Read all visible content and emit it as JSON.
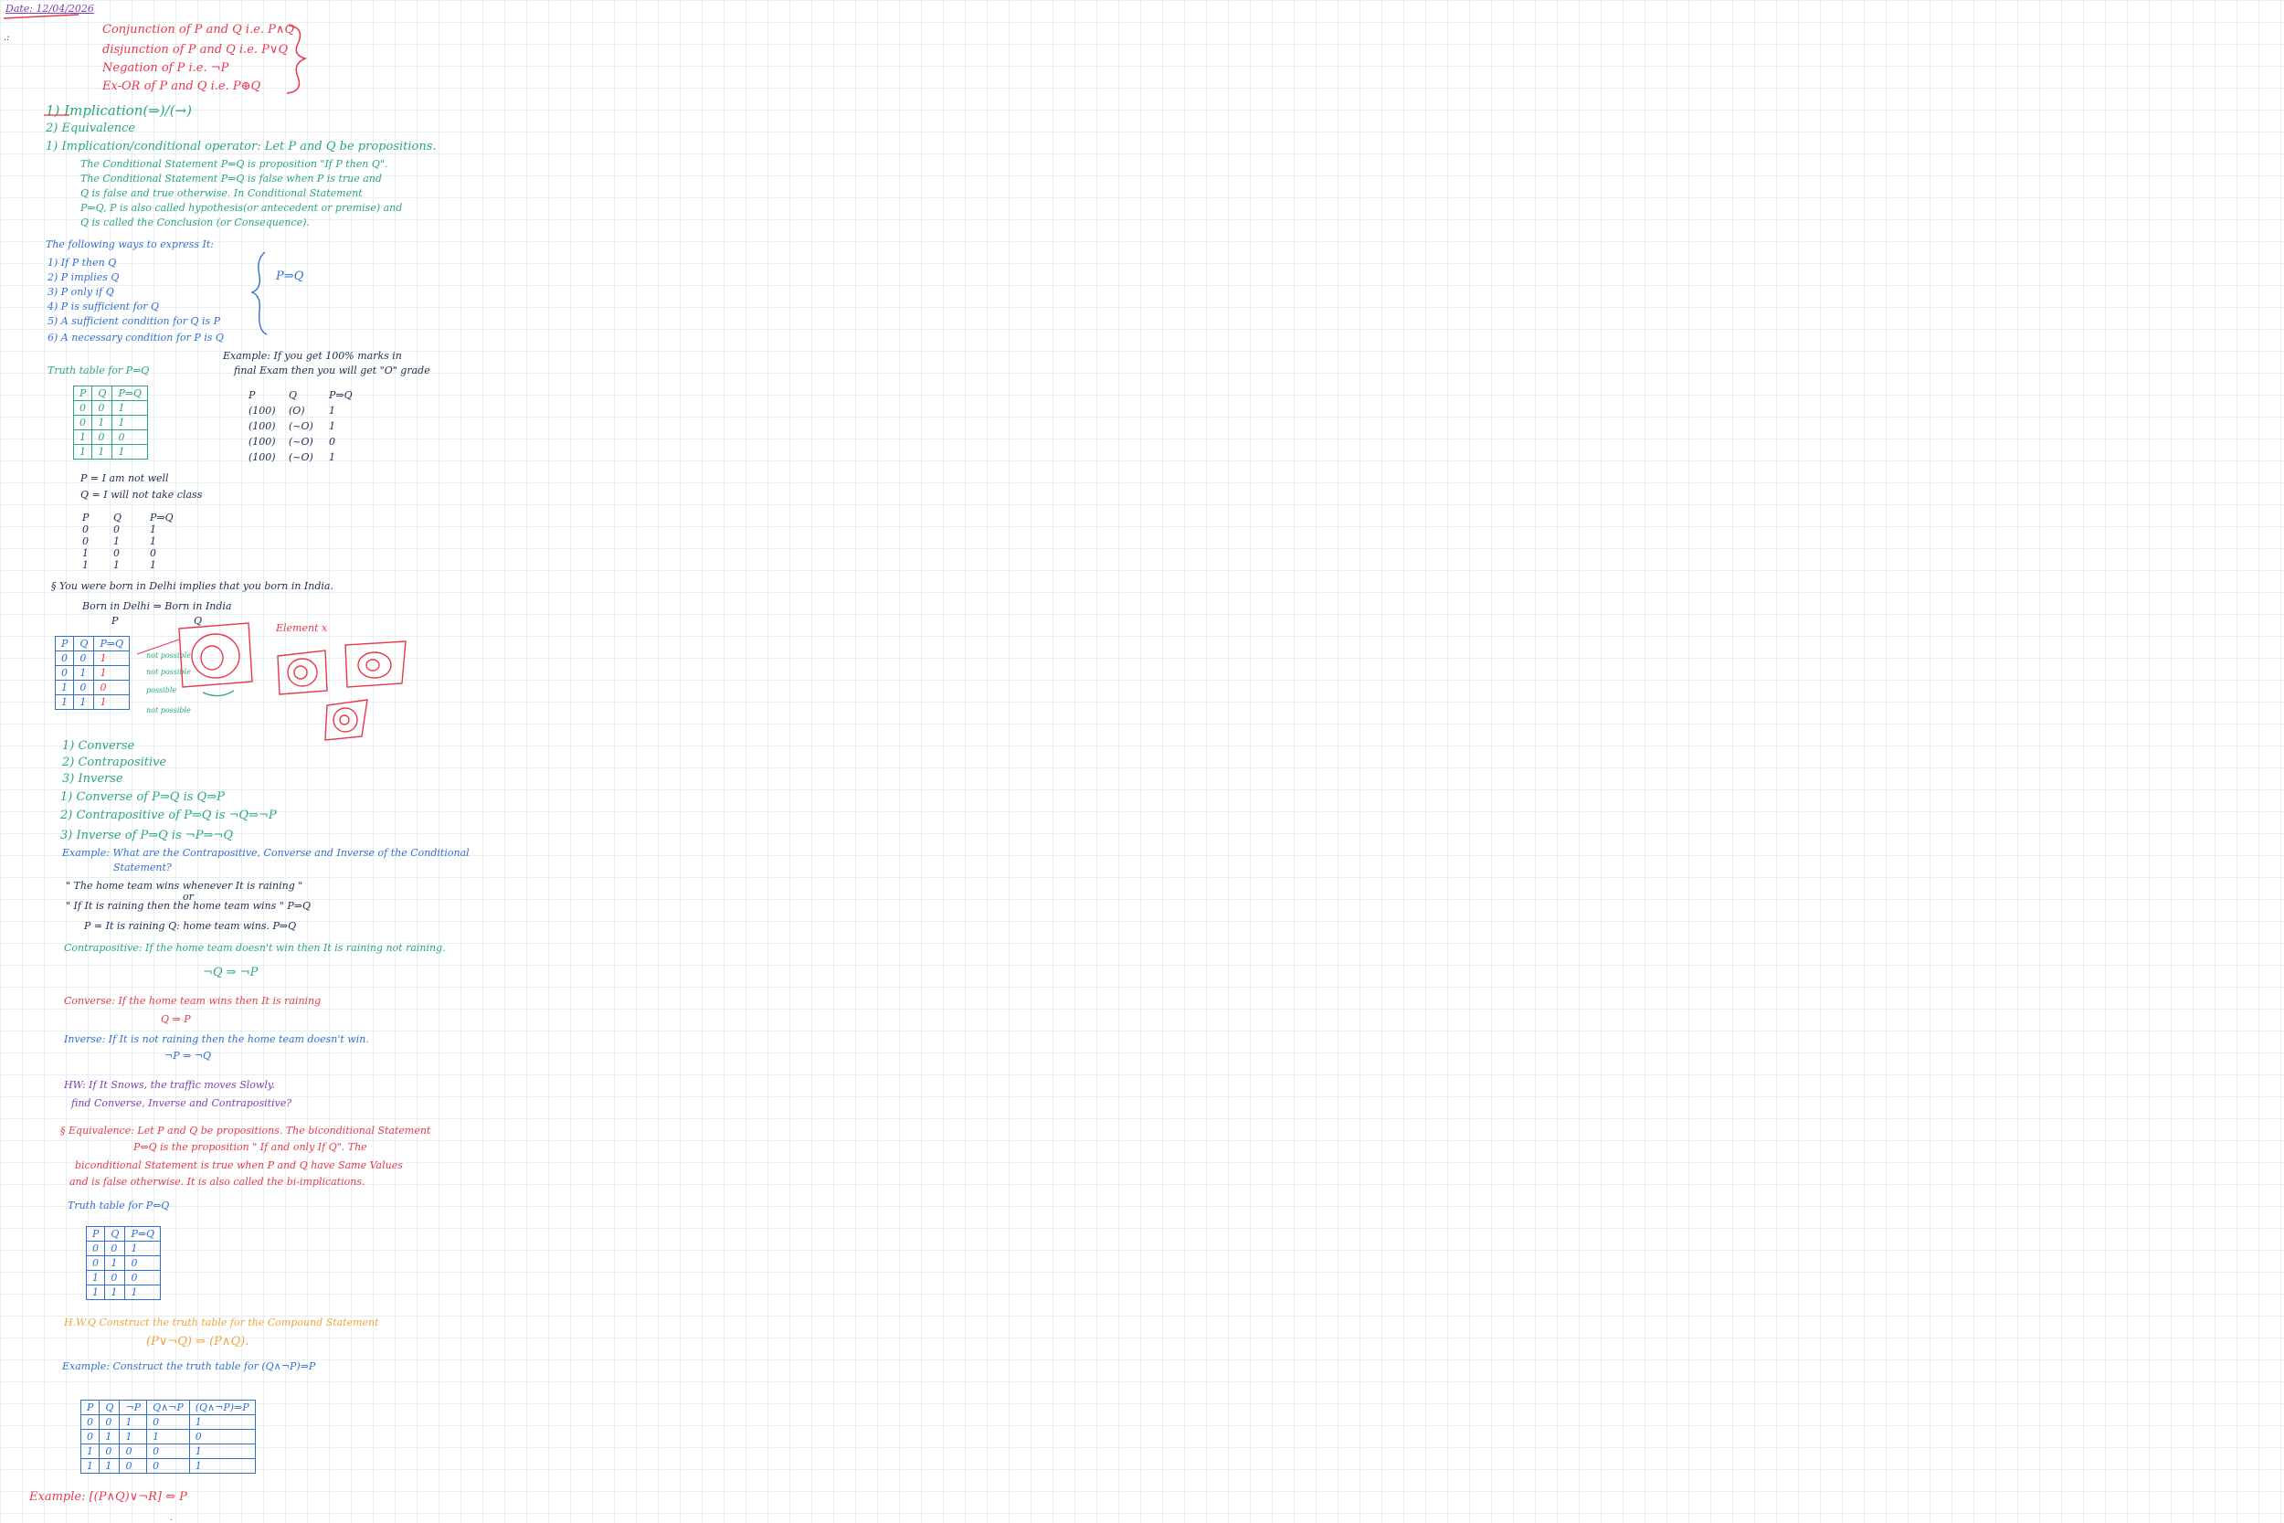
{
  "date": "Date: 12/04/2026",
  "intro": {
    "lines": [
      "Conjunction of P and Q  i.e. P∧Q",
      "disjunction of P and Q  i.e. P∨Q",
      "Negation of  P       i.e. ¬P",
      "Ex-OR of P and Q  i.e. P⊕Q"
    ]
  },
  "list1": [
    "1) Implication(⇒)/(→)",
    "2) Equivalence"
  ],
  "implication": {
    "heading": "1) Implication/conditional operator: Let P and Q be propositions.",
    "lines": [
      "The Conditional Statement P⇒Q is proposition \"If P then Q\".",
      "The Conditional Statement P⇒Q is false when P is true and",
      "Q is false and true otherwise. In Conditional Statement",
      "P⇒Q, P is also called hypothesis(or antecedent or premise) and",
      "Q is called the Conclusion (or Consequence)."
    ]
  },
  "ways": {
    "heading": "The following ways to express It:",
    "items": [
      "1) If P then Q",
      "2) P implies Q",
      "3) P only if Q",
      "4) P is sufficient for Q",
      "5) A sufficient condition for Q is P",
      "6) A necessary condition for P is Q"
    ],
    "result": "P⇒Q"
  },
  "truth_table_1": {
    "title": "Truth table for P⇒Q",
    "headers": [
      "P",
      "Q",
      "P⇒Q"
    ],
    "rows": [
      [
        "0",
        "0",
        "1"
      ],
      [
        "0",
        "1",
        "1"
      ],
      [
        "1",
        "0",
        "0"
      ],
      [
        "1",
        "1",
        "1"
      ]
    ]
  },
  "example_marks": {
    "line1": "Example: If you get 100% marks in",
    "line2": "final Exam then you will get \"O\" grade",
    "headers": [
      "P",
      "Q",
      "P⇒Q"
    ],
    "rows": [
      [
        "(100)",
        "(O)",
        "1"
      ],
      [
        "(100)",
        "(~O)",
        "1"
      ],
      [
        "(100)",
        "(~O)",
        "0"
      ],
      [
        "(100)",
        "(~O)",
        "1"
      ]
    ]
  },
  "notes_pq": [
    "P = I am not well",
    "Q = I will not take class"
  ],
  "small_table": {
    "headers": [
      "P",
      "Q",
      "P⇒Q"
    ],
    "rows": [
      [
        "0",
        "0",
        "1"
      ],
      [
        "0",
        "1",
        "1"
      ],
      [
        "1",
        "0",
        "0"
      ],
      [
        "1",
        "1",
        "1"
      ]
    ]
  },
  "delhi": {
    "line1": "§ You were born in Delhi implies that you born in India.",
    "line2": "Born in Delhi ⇒ Born in India",
    "p": "P",
    "q": "Q",
    "headers": [
      "P",
      "Q",
      "P⇒Q"
    ],
    "rows": [
      [
        "0",
        "0",
        "1"
      ],
      [
        "0",
        "1",
        "1"
      ],
      [
        "1",
        "0",
        "0"
      ],
      [
        "1",
        "1",
        "1"
      ]
    ],
    "side_labels": [
      "not possible",
      "not possible",
      "possible",
      "not possible"
    ],
    "element_label": "Element x"
  },
  "list2": [
    "1) Converse",
    "2) Contrapositive",
    "3) Inverse"
  ],
  "list3": [
    "1) Converse of P⇒Q is Q⇒P",
    "2) Contrapositive of P⇒Q is ¬Q⇒¬P",
    "3) Inverse of P⇒Q is ¬P⇒¬Q"
  ],
  "example_team": {
    "heading": "Example: What are the Contrapositive, Converse and Inverse of the Conditional",
    "heading2": "Statement?",
    "quote1": "\" The home team wins whenever It is raining \"",
    "or": "or",
    "quote2": "\" If It is raining then the home team wins \"  P⇒Q",
    "defs": "P = It is raining     Q: home team wins.     P⇒Q",
    "contra_label": "Contrapositive: If the home team doesn't win then It is raining not raining.",
    "contra_expr": "¬Q ⇒ ¬P",
    "converse_label": "Converse: If the home team wins then It is raining",
    "converse_expr": "Q ⇒ P",
    "inverse_label": "Inverse: If It is not raining then the home team doesn't win.",
    "inverse_expr": "¬P ⇒ ¬Q"
  },
  "hw1": {
    "line1": "HW: If It Snows, the traffic moves Slowly.",
    "line2": "find Converse, Inverse and Contrapositive?"
  },
  "equivalence": {
    "lines": [
      "§ Equivalence: Let P and Q be propositions. The biconditional Statement",
      "P⇔Q is the proposition \" If and only If Q\". The",
      "biconditional Statement is true when P and Q have Same Values",
      "and is false otherwise. It is also called the bi-implications."
    ]
  },
  "truth_table_2": {
    "title": "Truth table for P⇔Q",
    "headers": [
      "P",
      "Q",
      "P⇔Q"
    ],
    "rows": [
      [
        "0",
        "0",
        "1"
      ],
      [
        "0",
        "1",
        "0"
      ],
      [
        "1",
        "0",
        "0"
      ],
      [
        "1",
        "1",
        "1"
      ]
    ]
  },
  "hw2": {
    "line1": "H.W.Q Construct the truth table for the Compound Statement",
    "line2": "(P∨¬Q) ⇒ (P∧Q)."
  },
  "example_construct": "Example: Construct the truth table for (Q∧¬P)⇒P",
  "truth_table_3": {
    "headers": [
      "P",
      "Q",
      "¬P",
      "Q∧¬P",
      "(Q∧¬P)⇒P"
    ],
    "rows": [
      [
        "0",
        "0",
        "1",
        "0",
        "1"
      ],
      [
        "0",
        "1",
        "1",
        "1",
        "0"
      ],
      [
        "1",
        "0",
        "0",
        "0",
        "1"
      ],
      [
        "1",
        "1",
        "0",
        "0",
        "1"
      ]
    ]
  },
  "final_example": "Example:   [(P∧Q)∨¬R] ⇔ P"
}
